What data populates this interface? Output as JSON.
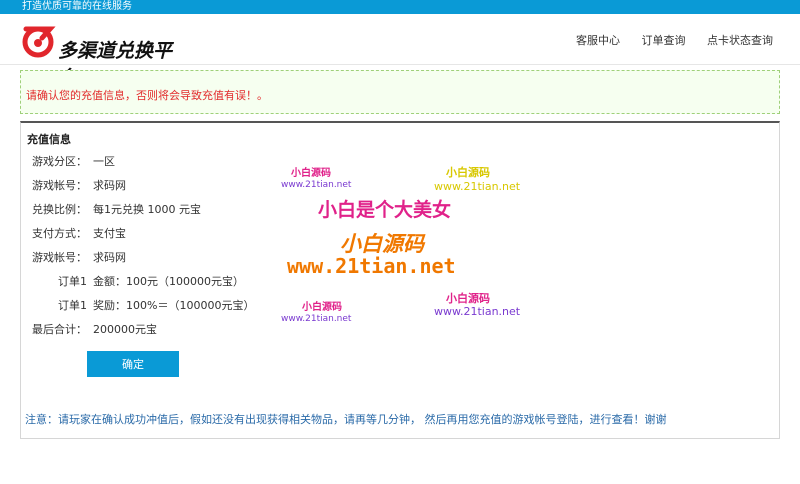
{
  "topbar": {
    "slogan": "打造优质可靠的在线服务"
  },
  "header": {
    "logo_text": "多渠道兑换平台",
    "nav": [
      "客服中心",
      "订单查询",
      "点卡状态查询"
    ]
  },
  "notice": {
    "text": "请确认您的充值信息，否则将会导致充值有误！。"
  },
  "panel": {
    "title": "充值信息",
    "rows": [
      {
        "label": "游戏分区：",
        "value": "一区"
      },
      {
        "label": "游戏帐号：",
        "value": "求码网"
      },
      {
        "label": "兑换比例：",
        "value": "每1元兑换 1000 元宝"
      },
      {
        "label": "支付方式：",
        "value": "支付宝"
      },
      {
        "label": "游戏帐号：",
        "value": "求码网"
      },
      {
        "label": "订单1",
        "value": "金额：100元（100000元宝）"
      },
      {
        "label": "订单1",
        "value": "奖励：100%＝（100000元宝）"
      },
      {
        "label": "最后合计：",
        "value": "200000元宝"
      }
    ],
    "confirm_label": "确定",
    "footnote": "注意：请玩家在确认成功冲值后，假如还没有出现获得相关物品，请再等几分钟，  然后再用您充值的游戏帐号登陆，进行查看！谢谢"
  },
  "watermarks": {
    "small_cn": "小白源码",
    "small_url": "www.21tian.net",
    "big_cn": "小白是个大美女",
    "mid_cn": "小白源码",
    "big_url": "www.21tian.net"
  },
  "colors": {
    "accent": "#0a9ad6",
    "notice_red": "#e22b2b",
    "wm_pink": "#e0228a",
    "wm_orange": "#f07800",
    "wm_purple": "#7a3ad0"
  }
}
